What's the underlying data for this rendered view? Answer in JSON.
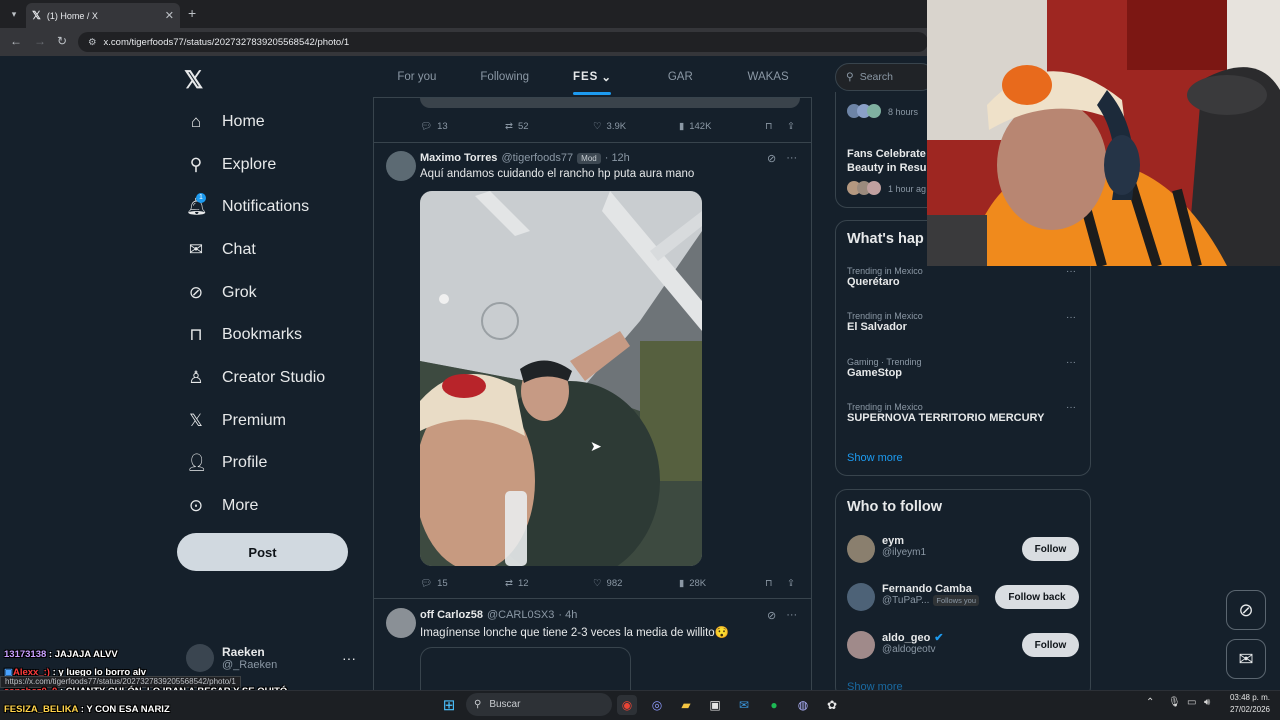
{
  "browser": {
    "tab_title": "(1) Home / X",
    "url": "x.com/tigerfoods77/status/2027327839205568542/photo/1",
    "status_url": "https://x.com/tigerfoods77/status/2027327839205568542/photo/1"
  },
  "nav": {
    "items": [
      {
        "label": "Home",
        "icon": "home-icon"
      },
      {
        "label": "Explore",
        "icon": "search-icon"
      },
      {
        "label": "Notifications",
        "icon": "bell-icon"
      },
      {
        "label": "Chat",
        "icon": "mail-icon"
      },
      {
        "label": "Grok",
        "icon": "grok-icon"
      },
      {
        "label": "Bookmarks",
        "icon": "bookmark-icon"
      },
      {
        "label": "Creator Studio",
        "icon": "creator-icon"
      },
      {
        "label": "Premium",
        "icon": "x-icon"
      },
      {
        "label": "Profile",
        "icon": "person-icon"
      },
      {
        "label": "More",
        "icon": "more-circle-icon"
      }
    ],
    "notification_count": "1",
    "post_label": "Post",
    "account": {
      "name": "Raeken",
      "handle": "@_Raeken"
    }
  },
  "feed_tabs": [
    "For you",
    "Following",
    "FES",
    "GAR",
    "WAKAS"
  ],
  "tweets": {
    "prev_stats": {
      "replies": "13",
      "reposts": "52",
      "likes": "3.9K",
      "views": "142K"
    },
    "main": {
      "name": "Maximo Torres",
      "handle": "@tigerfoods77",
      "badge": "Mod",
      "time": "· 12h",
      "text": "Aquí andamos cuidando el rancho hp puta aura mano",
      "stats": {
        "replies": "15",
        "reposts": "12",
        "likes": "982",
        "views": "28K"
      }
    },
    "next": {
      "name": "off Carloz58",
      "handle": "@CARL0SX3",
      "time": "· 4h",
      "text": "Imagínense lonche que tiene 2-3 veces la media de willito😯"
    }
  },
  "right": {
    "search_placeholder": "Search",
    "news": [
      {
        "title": "",
        "meta": "8 hours"
      },
      {
        "title": "Fans Celebrate",
        "title2": "Beauty in Resu",
        "meta": "1 hour ag"
      }
    ],
    "whats_happening_title": "What's hap",
    "trends": [
      {
        "meta": "Trending in Mexico",
        "name": "Querétaro"
      },
      {
        "meta": "Trending in Mexico",
        "name": "El Salvador"
      },
      {
        "meta": "Gaming · Trending",
        "name": "GameStop"
      },
      {
        "meta": "Trending in Mexico",
        "name": "SUPERNOVA TERRITORIO MERCURY"
      }
    ],
    "show_more": "Show more",
    "who_to_follow_title": "Who to follow",
    "who_to_follow": [
      {
        "name": "eym",
        "handle": "@ilyeym1",
        "button": "Follow",
        "follows_you": ""
      },
      {
        "name": "Fernando Camba",
        "handle": "@TuPaP...",
        "button": "Follow back",
        "follows_you": "Follows you"
      },
      {
        "name": "aldo_geo",
        "handle": "@aldogeotv",
        "button": "Follow",
        "follows_you": ""
      }
    ],
    "show_more_2": "Show more"
  },
  "chat": [
    {
      "user": "13173138",
      "msg": " : JAJAJA ALVV",
      "color": "#c9a0ff"
    },
    {
      "user": "Alexx_:)",
      "msg": " : y luego lo borro alv",
      "color": "#ff3b3b"
    },
    {
      "user": "sanchez0_0",
      "msg": " : CHANTY CULÓN, LO IBAN A BESAR Y SE QUITÓ",
      "color": "#ff3b3b"
    },
    {
      "user": "FESIZA_BELIKA",
      "msg": " : Y CON ESA NARIZ",
      "color": "#ffd34a"
    }
  ],
  "taskbar": {
    "search_label": "Buscar",
    "time": "03:48 p. m.",
    "date": "27/02/2026"
  }
}
